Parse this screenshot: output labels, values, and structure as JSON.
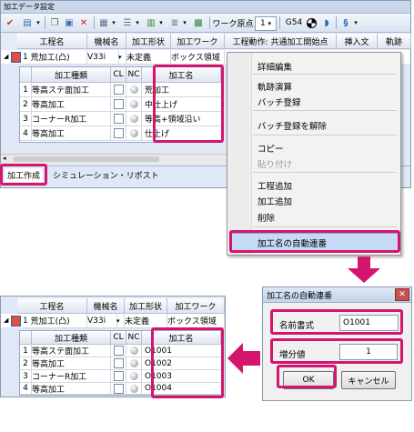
{
  "window": {
    "title": "加工データ設定"
  },
  "toolbar": {
    "workorigin_label": "ワーク原点",
    "workorigin_value": "1",
    "g54_label": "G54"
  },
  "main_columns": [
    "工程名",
    "機械名",
    "加工形状",
    "加工ワーク",
    "工程動作: 共通加工開始点",
    "挿入文",
    "軌跡"
  ],
  "process_row": {
    "index": "1",
    "name": "荒加工(凸)",
    "machine": "V33i",
    "shape": "未定義",
    "work": "ボックス領域"
  },
  "sub_columns": {
    "type": "加工種類",
    "cl": "CL",
    "nc": "NC",
    "name": "加工名"
  },
  "sub_rows": [
    {
      "index": "1",
      "type": "等高ステ面加工",
      "name": "荒加工"
    },
    {
      "index": "2",
      "type": "等高加工",
      "name": "中仕上げ"
    },
    {
      "index": "3",
      "type": "コーナーR加工",
      "name": "等高+領域沿い"
    },
    {
      "index": "4",
      "type": "等高加工",
      "name": "仕上げ"
    }
  ],
  "bottom_tabs": [
    "加工作成",
    "シミュレーション・リポスト"
  ],
  "context_menu": {
    "items": [
      {
        "label": "詳細編集",
        "enabled": true
      },
      {
        "label": "軌跡演算",
        "enabled": true
      },
      {
        "label": "バッチ登録",
        "enabled": true
      },
      {
        "label": "バッチ登録を解除",
        "enabled": true
      },
      {
        "label": "コピー",
        "enabled": true
      },
      {
        "label": "貼り付け",
        "enabled": false
      },
      {
        "label": "工程追加",
        "enabled": true
      },
      {
        "label": "加工追加",
        "enabled": true
      },
      {
        "label": "削除",
        "enabled": true
      },
      {
        "label": "加工名の自動連番",
        "enabled": true
      }
    ]
  },
  "dialog": {
    "title": "加工名の自動連番",
    "format_label": "名前書式",
    "format_value": "O1001",
    "increment_label": "増分値",
    "increment_value": "1",
    "ok": "OK",
    "cancel": "キャンセル"
  },
  "result": {
    "columns": [
      "工程名",
      "機械名",
      "加工形状",
      "加工ワーク"
    ],
    "process_row": {
      "index": "1",
      "name": "荒加工(凸)",
      "machine": "V33i",
      "shape": "未定義",
      "work": "ボックス領域"
    },
    "sub_columns": {
      "type": "加工種類",
      "cl": "CL",
      "nc": "NC",
      "name": "加工名"
    },
    "sub_rows": [
      {
        "index": "1",
        "type": "等高ステ面加工",
        "name": "O1001"
      },
      {
        "index": "2",
        "type": "等高加工",
        "name": "O1002"
      },
      {
        "index": "3",
        "type": "コーナーR加工",
        "name": "O1003"
      },
      {
        "index": "4",
        "type": "等高加工",
        "name": "O1004"
      }
    ]
  },
  "colors": {
    "highlight": "#d4156e",
    "selection": "#c6d9f5"
  }
}
